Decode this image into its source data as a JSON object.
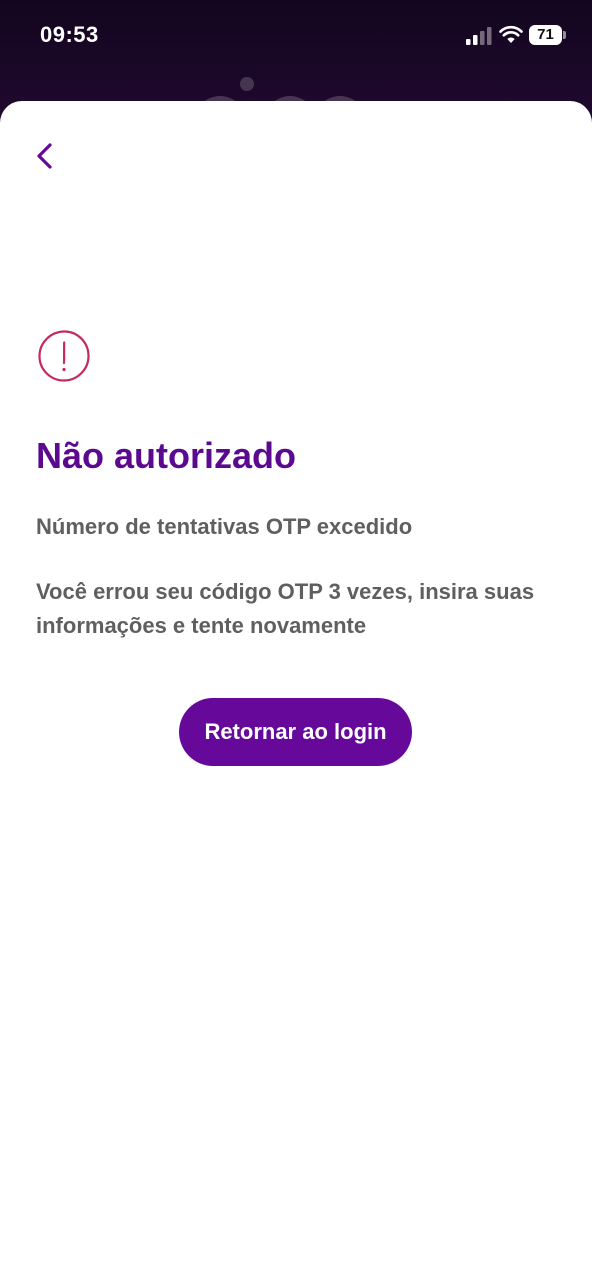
{
  "status_bar": {
    "time": "09:53",
    "battery_level": "71",
    "signal_icon": "cellular-signal-icon",
    "wifi_icon": "wifi-icon",
    "battery_icon": "battery-icon"
  },
  "header": {
    "back_icon": "chevron-left-icon"
  },
  "alert": {
    "icon": "exclamation-circle-icon"
  },
  "content": {
    "title": "Não autorizado",
    "subtitle": "Número de tentativas OTP excedido",
    "description": "Você errou seu código OTP 3 vezes, insira suas informações e tente novamente"
  },
  "actions": {
    "return_label": "Retornar ao login"
  },
  "colors": {
    "brand_purple": "#66099b",
    "title_purple": "#5b0a8f",
    "alert_red": "#c62860",
    "body_text": "#5f5f5f",
    "backdrop": "#1a0826"
  }
}
